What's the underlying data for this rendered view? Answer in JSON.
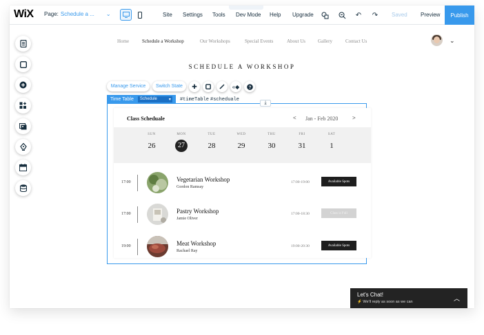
{
  "topbar": {
    "logo": "WiX",
    "page_label": "Page:",
    "page_value": "Schedule a ...",
    "menu": [
      "Site",
      "Settings",
      "Tools",
      "Dev Mode",
      "Help",
      "Upgrade"
    ],
    "saved": "Saved",
    "preview": "Preview",
    "publish": "Publish"
  },
  "left_toolbar": [
    "pages-icon",
    "background-icon",
    "add-icon",
    "add-apps-icon",
    "media-icon",
    "blog-icon",
    "bookings-icon",
    "database-icon"
  ],
  "site": {
    "nav": [
      "Home",
      "Schedule a Workshop",
      "Our Workshops",
      "Special Events",
      "About Us",
      "Gallery",
      "Contact Us"
    ],
    "active_nav": "Schedule a Workshop",
    "heading": "SCHEDULE A WORKSHOP"
  },
  "editor": {
    "manage_service": "Manage Service",
    "switch_state": "Switch State",
    "component_label": "Time Table",
    "state_select": "Schedule",
    "code_ids": [
      "#timeTable",
      "#scheduale"
    ]
  },
  "schedule": {
    "title": "Class Scheduale",
    "range": "Jan - Feb 2020",
    "prev": "<",
    "next": ">",
    "days": [
      {
        "name": "SUN",
        "date": "26"
      },
      {
        "name": "MON",
        "date": "27"
      },
      {
        "name": "TUE",
        "date": "28"
      },
      {
        "name": "WED",
        "date": "29"
      },
      {
        "name": "THU",
        "date": "30"
      },
      {
        "name": "FRI",
        "date": "31"
      },
      {
        "name": "SAT",
        "date": "1"
      }
    ],
    "selected_day": "27",
    "classes": [
      {
        "time": "17:00",
        "name": "Vegetarian Workshop",
        "instructor": "Gordon Ramsay",
        "hours": "17:00-19:00",
        "status": "Available Spots"
      },
      {
        "time": "17:00",
        "name": "Pastry Workshop",
        "instructor": "Jamie Oliver",
        "hours": "17:00-18:30",
        "status": "Class is Full"
      },
      {
        "time": "19:00",
        "name": "Meat Workshop",
        "instructor": "Rachael Ray",
        "hours": "19:00-20:30",
        "status": "Available Spots"
      }
    ]
  },
  "chat": {
    "title": "Let's Chat!",
    "subtitle": "We'll reply as soon as we can"
  }
}
